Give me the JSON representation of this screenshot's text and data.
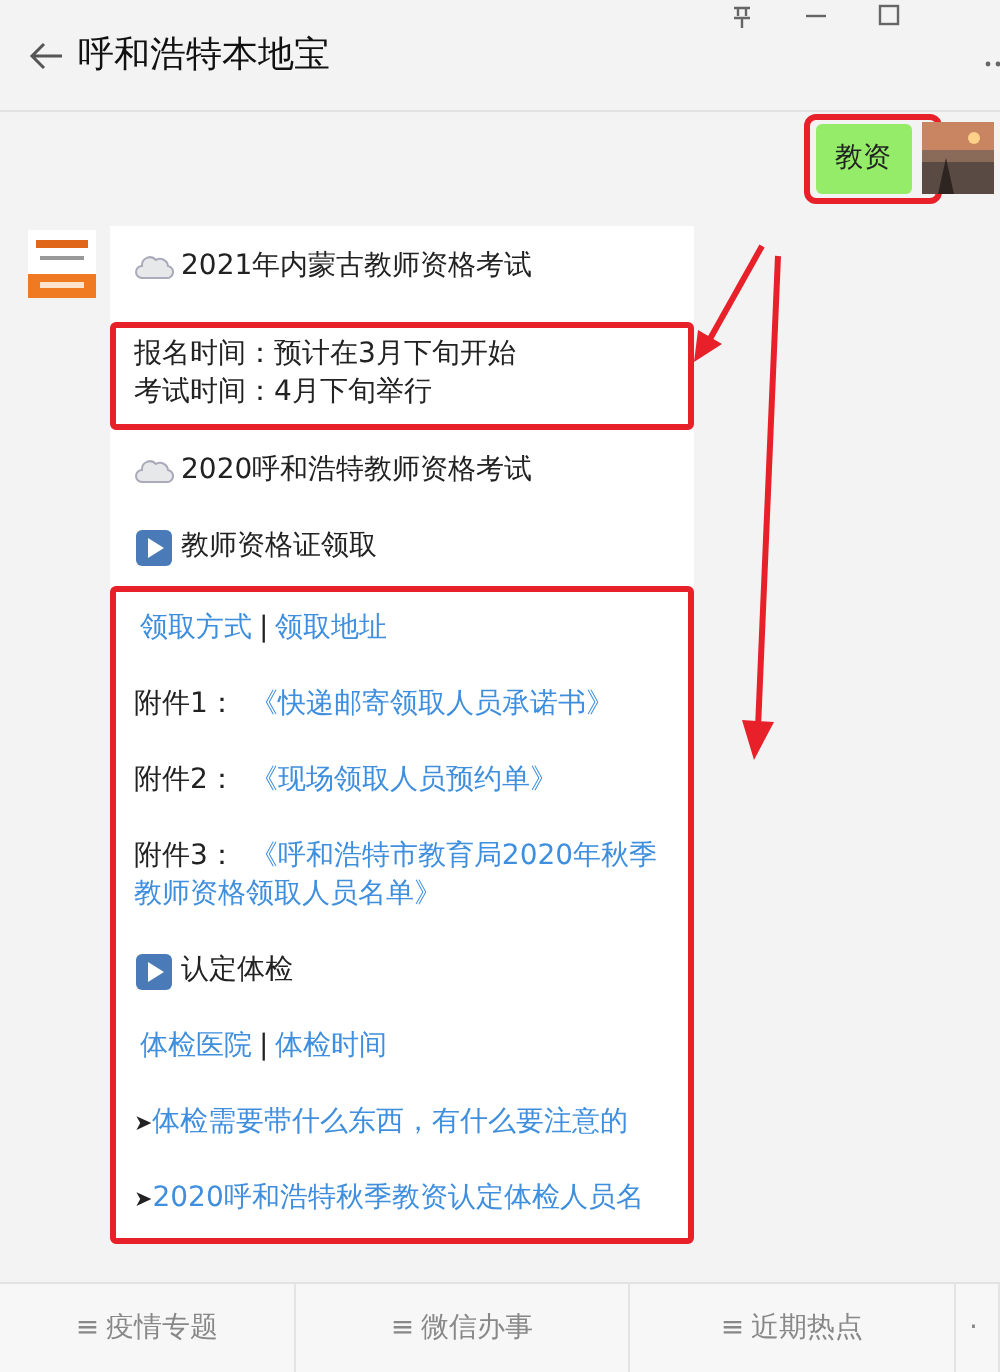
{
  "header": {
    "title": "呼和浩特本地宝"
  },
  "sent_message": {
    "text": "教资",
    "highlighted": true
  },
  "blocks": [
    {
      "highlighted": false,
      "items": [
        {
          "kind": "cloud",
          "text": "2021年内蒙古教师资格考试"
        }
      ]
    },
    {
      "highlighted": true,
      "items": [
        {
          "kind": "lines",
          "lines": [
            "报名时间：预计在3月下旬开始",
            "考试时间：4月下旬举行"
          ]
        }
      ]
    },
    {
      "highlighted": false,
      "items": [
        {
          "kind": "cloud",
          "text": "2020呼和浩特教师资格考试"
        },
        {
          "kind": "play",
          "text": "教师资格证领取"
        }
      ]
    },
    {
      "highlighted": true,
      "items": [
        {
          "kind": "links",
          "links": [
            "领取方式",
            "领取地址"
          ],
          "separator": "|"
        },
        {
          "kind": "attachment",
          "label": "附件1：",
          "link": "《快递邮寄领取人员承诺书》"
        },
        {
          "kind": "attachment",
          "label": "附件2：",
          "link": "《现场领取人员预约单》"
        },
        {
          "kind": "attachment",
          "label": "附件3：",
          "link": "《呼和浩特市教育局2020年秋季教师资格领取人员名单》"
        },
        {
          "kind": "play",
          "text": "认定体检"
        },
        {
          "kind": "links",
          "links": [
            "体检医院",
            "体检时间"
          ],
          "separator": "|"
        },
        {
          "kind": "arrow",
          "marker": "➤",
          "link": "体检需要带什么东西，有什么要注意的"
        },
        {
          "kind": "arrow",
          "marker": "➤",
          "link": "2020呼和浩特秋季教资认定体检人员名"
        }
      ]
    }
  ],
  "bottom_menu": [
    {
      "icon": "≡",
      "label": "疫情专题"
    },
    {
      "icon": "≡",
      "label": "微信办事"
    },
    {
      "icon": "≡",
      "label": "近期热点"
    },
    {
      "icon": "·"
    }
  ]
}
